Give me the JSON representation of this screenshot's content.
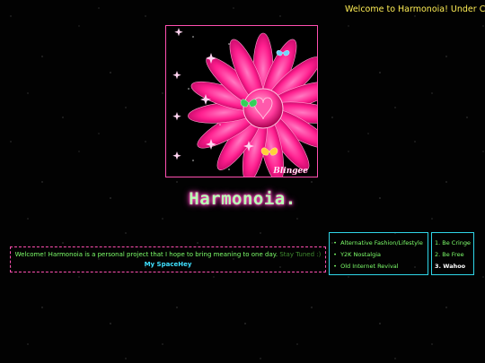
{
  "marquee": {
    "text": "Welcome to Harmonoia! Under Constru"
  },
  "banner": {
    "watermark": "Blingee"
  },
  "site": {
    "title": "Harmonoia."
  },
  "welcome": {
    "text": "Welcome! Harmonoia is a personal project that I hope to bring meaning to one day.",
    "stay_tuned": "Stay Tuned :)",
    "link_label": "My SpaceHey"
  },
  "topics": {
    "items": [
      {
        "label": "Alternative Fashion/Lifestyle"
      },
      {
        "label": "Y2K Nostalgia"
      },
      {
        "label": "Old Internet Revival"
      }
    ]
  },
  "rules": {
    "items": [
      {
        "label": "1. Be Cringe"
      },
      {
        "label": "2. Be Free"
      },
      {
        "label": "3. Wahoo"
      }
    ]
  },
  "colors": {
    "background": "#020202",
    "accent_pink": "#ff4fb0",
    "accent_cyan": "#2fd5e8",
    "text_green": "#7dff6a",
    "marquee_yellow": "#ffee55"
  }
}
